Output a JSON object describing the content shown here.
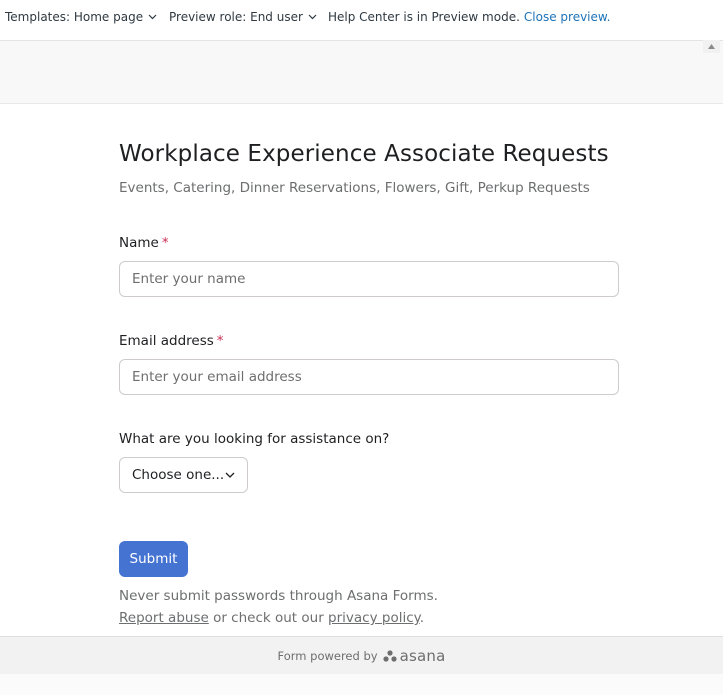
{
  "topbar": {
    "templates_label": "Templates: Home page",
    "preview_role_label": "Preview role: End user",
    "preview_status": "Help Center is in Preview mode.",
    "close_preview": "Close preview."
  },
  "form": {
    "title": "Workplace Experience Associate Requests",
    "subtitle": "Events, Catering, Dinner Reservations, Flowers, Gift, Perkup Requests",
    "name_label": "Name",
    "name_placeholder": "Enter your name",
    "email_label": "Email address",
    "email_placeholder": "Enter your email address",
    "required_mark": "*",
    "assistance_label": "What are you looking for assistance on?",
    "assistance_select": "Choose one...",
    "submit_label": "Submit",
    "passwords_note": "Never submit passwords through Asana Forms.",
    "report_abuse": "Report abuse",
    "or_text": " or check out our ",
    "privacy_policy": "privacy policy",
    "period": "."
  },
  "footer": {
    "powered_by": "Form powered by",
    "brand": "asana"
  },
  "colors": {
    "accent": "#4573d2",
    "link": "#1f73b7",
    "required": "#c92f54"
  }
}
